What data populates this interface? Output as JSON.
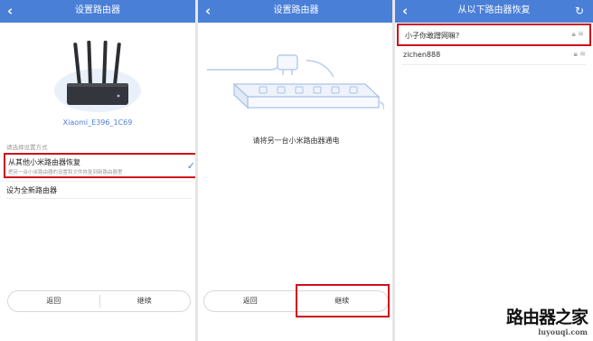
{
  "panel1": {
    "back_icon": "back-arrow-icon",
    "title": "设置路由器",
    "router_name": "Xiaomi_E396_1C69",
    "section_label": "请选择设置方式",
    "option_restore_title": "从其他小米路由器恢复",
    "option_restore_desc": "把另一台小米路由器的设置和文件恢复到新路由器里",
    "option_new": "设为全新路由器",
    "back_button": "返回",
    "continue_button": "继续"
  },
  "panel2": {
    "back_icon": "back-arrow-icon",
    "title": "设置路由器",
    "instruction": "请将另一台小米路由器通电",
    "back_button": "返回",
    "continue_button": "继续"
  },
  "panel3": {
    "back_icon": "back-arrow-icon",
    "title": "从以下路由器恢复",
    "refresh_icon": "refresh-icon",
    "networks": [
      {
        "ssid": "小子你敢蹭网嘛?"
      },
      {
        "ssid": "zichen888"
      }
    ]
  },
  "watermark": {
    "line1": "路由器之家",
    "line2": "luyouqi.com"
  },
  "colors": {
    "header_blue": "#4a7fd8",
    "highlight_red": "#d0101a",
    "accent_blue": "#4a7fd8"
  }
}
